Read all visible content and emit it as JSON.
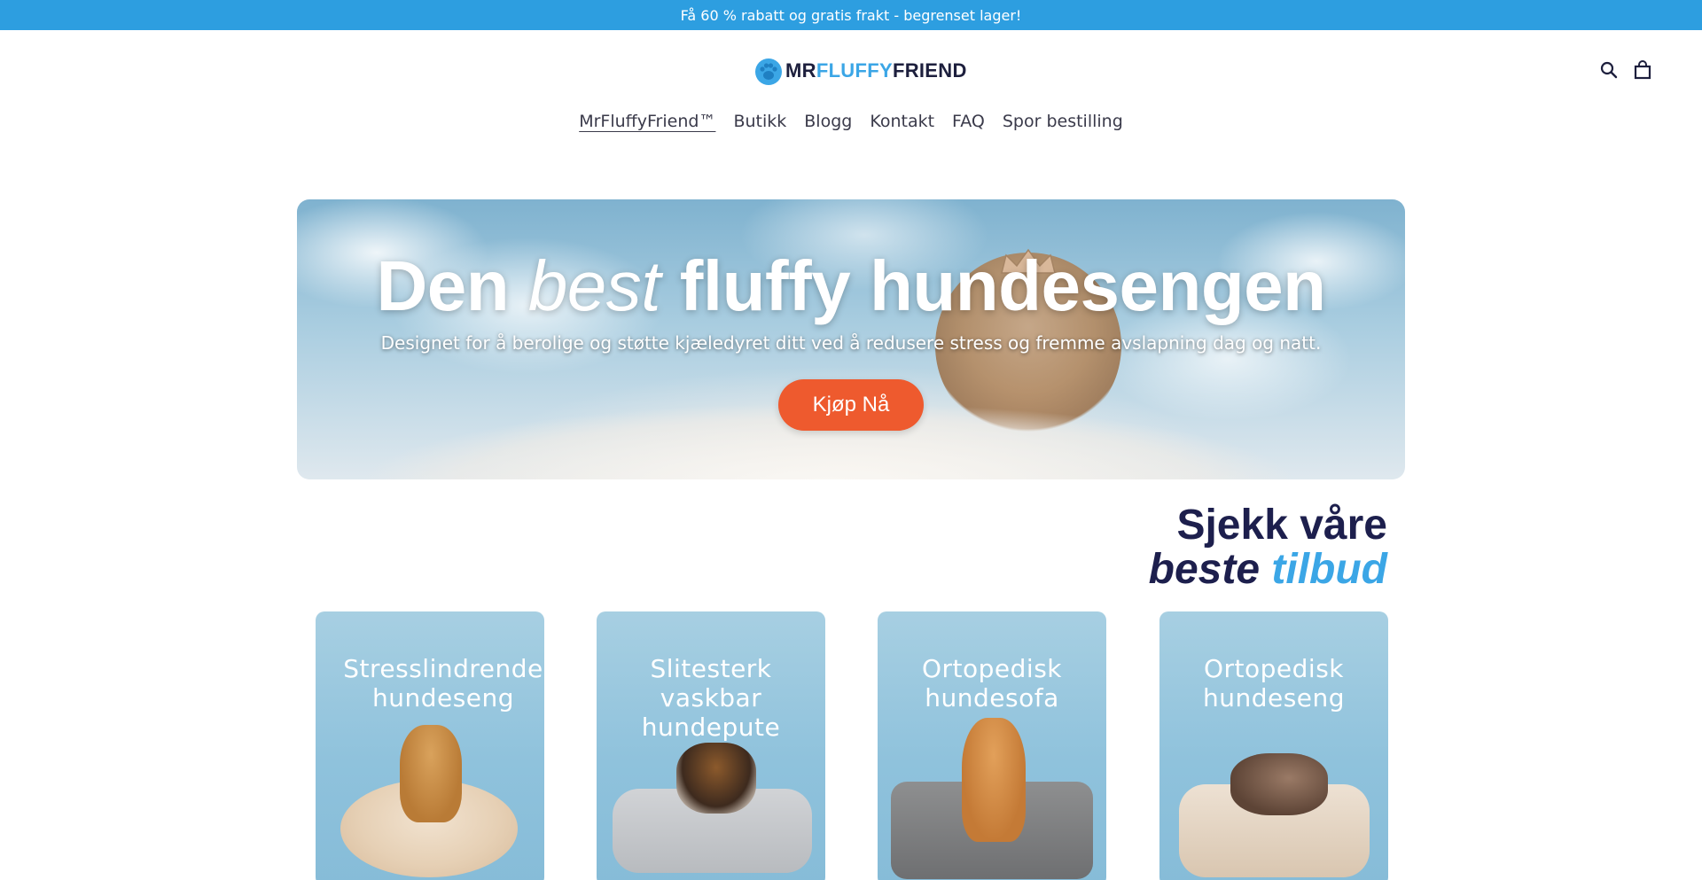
{
  "announcement": "Få 60 % rabatt og gratis frakt - begrenset lager!",
  "logo": {
    "part1": "MR",
    "part2": "FLUFFY",
    "part3": "FRIEND"
  },
  "header_icons": [
    "search-icon",
    "cart-icon"
  ],
  "nav": {
    "items": [
      {
        "label": "MrFluffyFriend™",
        "active": true
      },
      {
        "label": "Butikk",
        "active": false
      },
      {
        "label": "Blogg",
        "active": false
      },
      {
        "label": "Kontakt",
        "active": false
      },
      {
        "label": "FAQ",
        "active": false
      },
      {
        "label": "Spor bestilling",
        "active": false
      }
    ]
  },
  "hero": {
    "title_pre": "Den",
    "title_em": "best",
    "title_post": "fluffy hundesengen",
    "subtitle": "Designet for å berolige og støtte kjæledyret ditt ved å redusere stress og fremme avslapning dag og natt.",
    "cta": "Kjøp Nå"
  },
  "offers": {
    "line1": "Sjekk våre",
    "line2_a": "beste",
    "line2_b": "tilbud"
  },
  "products": [
    {
      "title": "Stresslindrende hundeseng"
    },
    {
      "title": "Slitesterk vaskbar hundepute"
    },
    {
      "title": "Ortopedisk hundesofa"
    },
    {
      "title": "Ortopedisk hundeseng"
    }
  ],
  "colors": {
    "announcement_bg": "#2d9ee0",
    "brand_blue": "#3ba6e6",
    "brand_navy": "#1d1f4d",
    "cta_orange": "#ee5a2e"
  }
}
